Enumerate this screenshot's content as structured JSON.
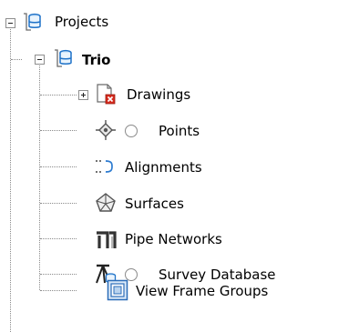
{
  "tree": {
    "root": {
      "label": "Projects",
      "icon": "database-folder-icon"
    },
    "project": {
      "label": "Trio",
      "icon": "database-folder-icon"
    },
    "items": [
      {
        "label": "Drawings",
        "icon": "drawings-error-icon",
        "expandable": true
      },
      {
        "label": "Points",
        "icon": "points-crosshair-icon",
        "radio": true
      },
      {
        "label": "Alignments",
        "icon": "alignments-icon"
      },
      {
        "label": "Surfaces",
        "icon": "surfaces-icon"
      },
      {
        "label": "Pipe Networks",
        "icon": "pipe-networks-icon"
      },
      {
        "label": "Survey Database",
        "icon": "survey-database-icon",
        "radio": true
      },
      {
        "label": "View Frame Groups",
        "icon": "view-frame-groups-icon"
      }
    ]
  }
}
